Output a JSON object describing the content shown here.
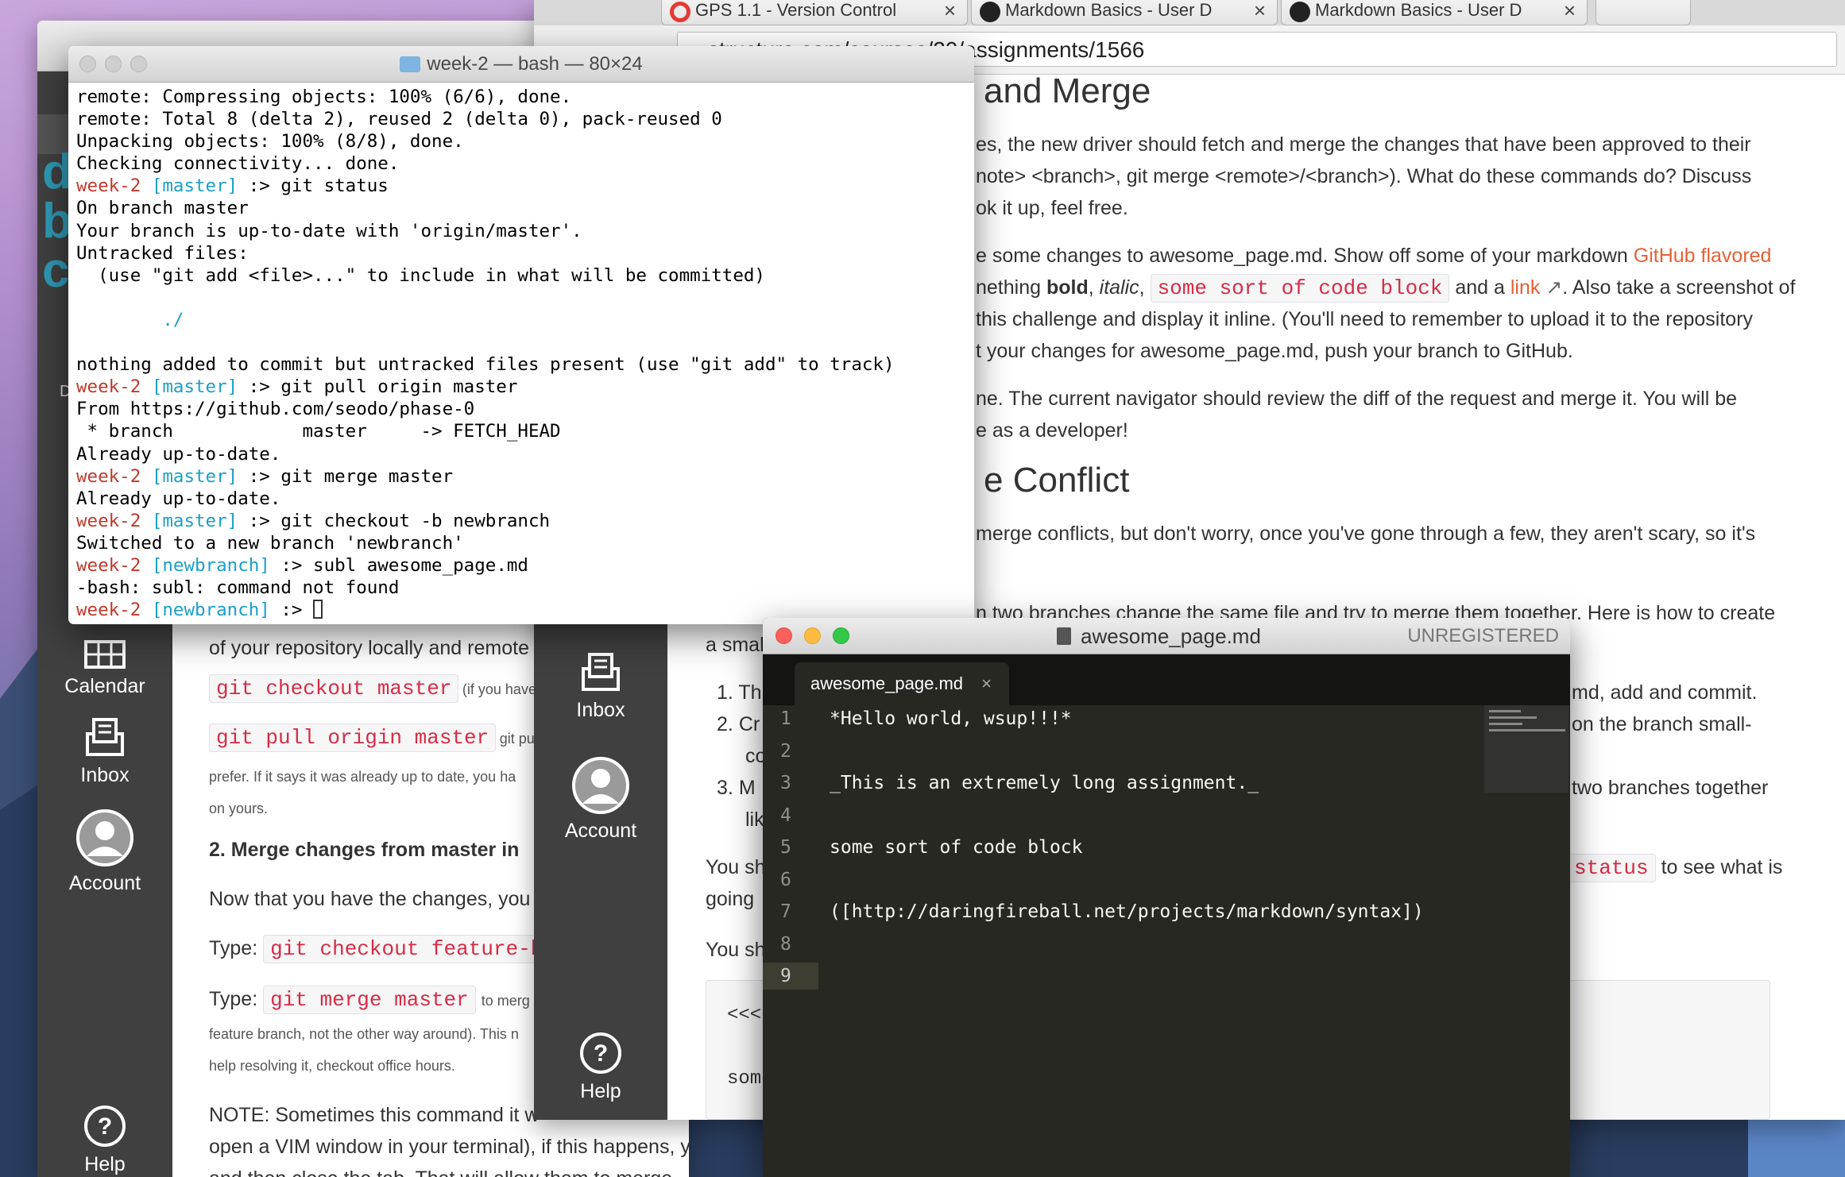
{
  "terminal": {
    "title": "week-2 — bash — 80×24",
    "lines": [
      {
        "prompt": "",
        "branch": "",
        "text": "remote: Compressing objects: 100% (6/6), done."
      },
      {
        "prompt": "",
        "branch": "",
        "text": "remote: Total 8 (delta 2), reused 2 (delta 0), pack-reused 0"
      },
      {
        "prompt": "",
        "branch": "",
        "text": "Unpacking objects: 100% (8/8), done."
      },
      {
        "prompt": "",
        "branch": "",
        "text": "Checking connectivity... done."
      },
      {
        "prompt": "week-2 ",
        "branch": "[master]",
        "text": " :> git status"
      },
      {
        "prompt": "",
        "branch": "",
        "text": "On branch master"
      },
      {
        "prompt": "",
        "branch": "",
        "text": "Your branch is up-to-date with 'origin/master'."
      },
      {
        "prompt": "",
        "branch": "",
        "text": "Untracked files:"
      },
      {
        "prompt": "",
        "branch": "",
        "text": "  (use \"git add <file>...\" to include in what will be committed)"
      },
      {
        "prompt": "",
        "branch": "",
        "text": ""
      },
      {
        "prompt": "",
        "branch": "",
        "text": "        ./",
        "cyan": true
      },
      {
        "prompt": "",
        "branch": "",
        "text": ""
      },
      {
        "prompt": "",
        "branch": "",
        "text": "nothing added to commit but untracked files present (use \"git add\" to track)"
      },
      {
        "prompt": "week-2 ",
        "branch": "[master]",
        "text": " :> git pull origin master"
      },
      {
        "prompt": "",
        "branch": "",
        "text": "From https://github.com/seodo/phase-0"
      },
      {
        "prompt": "",
        "branch": "",
        "text": " * branch            master     -> FETCH_HEAD"
      },
      {
        "prompt": "",
        "branch": "",
        "text": "Already up-to-date."
      },
      {
        "prompt": "week-2 ",
        "branch": "[master]",
        "text": " :> git merge master"
      },
      {
        "prompt": "",
        "branch": "",
        "text": "Already up-to-date."
      },
      {
        "prompt": "week-2 ",
        "branch": "[master]",
        "text": " :> git checkout -b newbranch"
      },
      {
        "prompt": "",
        "branch": "",
        "text": "Switched to a new branch 'newbranch'"
      },
      {
        "prompt": "week-2 ",
        "branch": "[newbranch]",
        "text": " :> subl awesome_page.md"
      },
      {
        "prompt": "",
        "branch": "",
        "text": "-bash: subl: command not found"
      },
      {
        "prompt": "week-2 ",
        "branch": "[newbranch]",
        "text": " :> "
      }
    ]
  },
  "browser": {
    "tabs": [
      "GPS 1.1 - Version Control",
      "Markdown Basics - User D",
      "Markdown Basics - User D"
    ],
    "url": "structure.com/courses/20/assignments/1566",
    "heading1": "and Merge",
    "para1": [
      "es, the new driver should fetch and merge the changes that have been approved to their",
      "note> <branch>, git merge <remote>/<branch>). What do these commands do? Discuss",
      "ok it up, feel free."
    ],
    "para2a": "e some changes to awesome_page.md. Show off some of your markdown ",
    "para2link": "GitHub flavored",
    "para2b_pre": "nething ",
    "bold": "bold",
    "italic": "italic",
    "code_block": "some sort of code block",
    "and_a": " and a ",
    "link": "link",
    "para2c": ". Also take a screenshot of",
    "para2d": "this challenge and display it inline. (You'll need to remember to upload it to the repository",
    "para2e": "t your changes for awesome_page.md, push your branch to GitHub.",
    "para3": [
      "ne. The current navigator should review the diff of the request and merge it. You will be",
      "e as a developer!"
    ],
    "heading2": "e Conflict",
    "para4": [
      "merge conflicts, but don't worry, once you've gone through a few, they aren't scary, so it's"
    ],
    "para5": "n two branches change the same file and try to merge them together. Here is how to create",
    "para5b": "a smal",
    "list": [
      {
        "n": "1.",
        "t": "Th"
      },
      {
        "n": "2.",
        "t": "Cr"
      },
      {
        "n": "3.",
        "t": "M"
      }
    ],
    "list_right": [
      "md, add and commit.",
      "on the branch small-",
      "two branches together"
    ],
    "list_extra": [
      "co",
      "lik"
    ],
    "you_sh": "You sh",
    "going": "going",
    "status_code": "status",
    "to_see": " to see what is",
    "you_sh2": "You sh",
    "conflict_a": "<<<",
    "conflict_b": "some",
    "nav": {
      "inbox": "Inbox",
      "account": "Account",
      "help": "Help"
    }
  },
  "backpage": {
    "para_top": "of your repository locally and remote",
    "code1": "git checkout master",
    "code1_note": "(if you have t",
    "code2": "git pull origin master",
    "code2_note": "git pul",
    "prefer": "prefer. If it says it was already up to date, you ha",
    "on_yours": "on yours.",
    "step2": "2. Merge changes from master in",
    "now_that": "Now that you have the changes, you",
    "type1": "Type: ",
    "code3": "git checkout feature-br",
    "type2": "Type: ",
    "code4": "git merge master",
    "code4_note": "to merg",
    "feature": "feature branch, not the other way around). This n",
    "help_res": "help resolving it, checkout office hours.",
    "note1": "NOTE: Sometimes this command it w",
    "note2": "open a VIM window in your terminal), if this happens, you shou",
    "note3": "and then close the tab. That will allow them to merge.",
    "nav": {
      "calendar": "Calendar",
      "inbox": "Inbox",
      "account": "Account",
      "help": "Help"
    },
    "side_letters": [
      "d",
      "b",
      "c"
    ],
    "side_d": "D"
  },
  "sublime": {
    "title": "awesome_page.md",
    "unregistered": "UNREGISTERED",
    "tab": "awesome_page.md",
    "lines": [
      "*Hello world, wsup!!!*",
      "",
      "_This is an extremely long assignment._",
      "",
      "some sort of code block",
      "",
      "([http://daringfireball.net/projects/markdown/syntax])",
      "",
      ""
    ]
  },
  "colors": {
    "accent_red": "#d62b46",
    "link_orange": "#e66135",
    "canvas_nav": "#404040",
    "editor_bg": "#272822"
  }
}
